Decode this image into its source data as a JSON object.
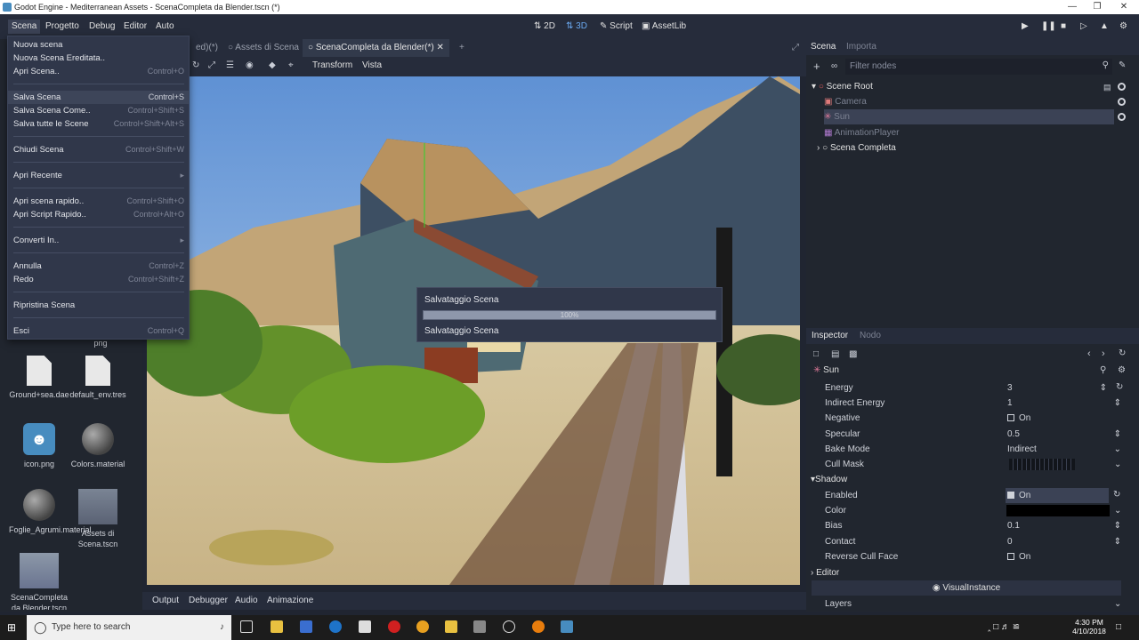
{
  "window": {
    "title": "Godot Engine - Mediterranean Assets - ScenaCompleta da Blender.tscn (*)"
  },
  "menubar": {
    "scene": "Scena",
    "project": "Progetto",
    "debug": "Debug",
    "editor": "Editor",
    "help": "Auto",
    "mode_2d": "2D",
    "mode_3d": "3D",
    "mode_script": "Script",
    "mode_assetlib": "AssetLib"
  },
  "scene_menu": {
    "items": [
      {
        "label": "Nuova scena",
        "shortcut": ""
      },
      {
        "label": "Nuova Scena Ereditata..",
        "shortcut": ""
      },
      {
        "label": "Apri Scena..",
        "shortcut": "Control+O"
      },
      {
        "label": "Salva Scena",
        "shortcut": "Control+S"
      },
      {
        "label": "Salva Scena Come..",
        "shortcut": "Control+Shift+S"
      },
      {
        "label": "Salva tutte le Scene",
        "shortcut": "Control+Shift+Alt+S"
      },
      {
        "label": "Chiudi Scena",
        "shortcut": "Control+Shift+W"
      },
      {
        "label": "Apri Recente",
        "shortcut": ""
      },
      {
        "label": "Apri scena rapido..",
        "shortcut": "Control+Shift+O"
      },
      {
        "label": "Apri Script Rapido..",
        "shortcut": "Control+Alt+O"
      },
      {
        "label": "Converti In..",
        "shortcut": ""
      },
      {
        "label": "Annulla",
        "shortcut": "Control+Z"
      },
      {
        "label": "Redo",
        "shortcut": "Control+Shift+Z"
      },
      {
        "label": "Ripristina Scena",
        "shortcut": ""
      },
      {
        "label": "Esci",
        "shortcut": "Control+Q"
      }
    ]
  },
  "tabs": [
    {
      "label": "ed)(*)"
    },
    {
      "label": "Assets di Scena"
    },
    {
      "label": "ScenaCompleta da Blender(*)"
    }
  ],
  "viewport_toolbar": {
    "transform": "Transform",
    "view": "Vista"
  },
  "filesystem": {
    "items": [
      {
        "label": "png"
      },
      {
        "label": "Ground+sea.dae"
      },
      {
        "label": "default_env.tres"
      },
      {
        "label": "icon.png"
      },
      {
        "label": "Colors.material"
      },
      {
        "label": "Foglie_Agrumi.material"
      },
      {
        "label": "Assets di Scena.tscn"
      },
      {
        "label": "ScenaCompleta da Blender.tscn"
      }
    ]
  },
  "save_dialog": {
    "title": "Salvataggio Scena",
    "progress_text": "100%",
    "progress": 1.0,
    "status": "Salvataggio Scena"
  },
  "bottom_panel": {
    "output": "Output",
    "debugger": "Debugger",
    "audio": "Audio",
    "animation": "Animazione"
  },
  "scene_dock": {
    "tab_scene": "Scena",
    "tab_import": "Importa",
    "filter_placeholder": "Filter nodes",
    "nodes": [
      {
        "label": "Scene Root"
      },
      {
        "label": "Camera"
      },
      {
        "label": "Sun"
      },
      {
        "label": "AnimationPlayer"
      },
      {
        "label": "Scena Completa"
      }
    ]
  },
  "inspector": {
    "tab_inspector": "Inspector",
    "tab_node": "Nodo",
    "object": "Sun",
    "props": [
      {
        "name": "Energy",
        "value": "3"
      },
      {
        "name": "Indirect Energy",
        "value": "1"
      },
      {
        "name": "Negative",
        "value": "On"
      },
      {
        "name": "Specular",
        "value": "0.5"
      },
      {
        "name": "Bake Mode",
        "value": "Indirect"
      },
      {
        "name": "Cull Mask",
        "value": ""
      }
    ],
    "shadow_section": "Shadow",
    "shadow_props": [
      {
        "name": "Enabled",
        "value": "On"
      },
      {
        "name": "Color",
        "value": ""
      },
      {
        "name": "Bias",
        "value": "0.1"
      },
      {
        "name": "Contact",
        "value": "0"
      },
      {
        "name": "Reverse Cull Face",
        "value": "On"
      }
    ],
    "editor_section": "Editor",
    "visual_instance": "VisualInstance",
    "layers": "Layers"
  },
  "taskbar": {
    "search_placeholder": "Type here to search",
    "time": "4:30 PM",
    "date": "4/10/2018"
  },
  "colors": {
    "accent": "#478cbf",
    "panel": "#21262f",
    "menu": "#30374a"
  }
}
